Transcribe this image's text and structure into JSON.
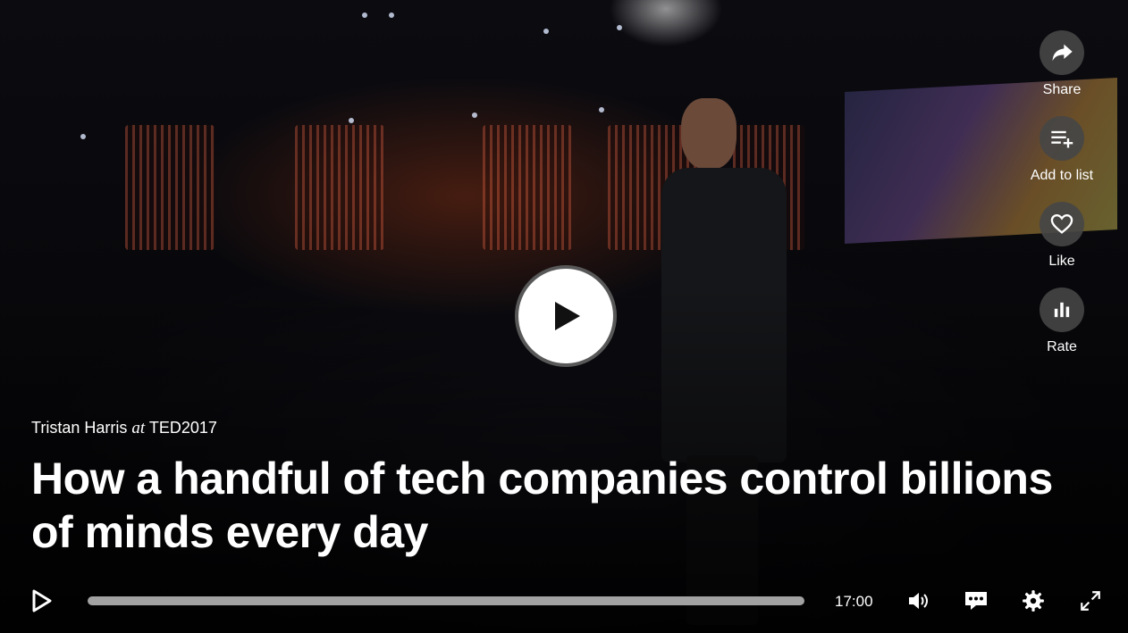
{
  "actions": {
    "share_label": "Share",
    "add_to_list_label": "Add to list",
    "like_label": "Like",
    "rate_label": "Rate"
  },
  "talk": {
    "speaker": "Tristan Harris",
    "at": "at",
    "event": "TED2017",
    "title": "How a handful of tech companies control billions of minds every day"
  },
  "player": {
    "duration": "17:00",
    "progress_fraction": 0,
    "icons": [
      "play-icon",
      "volume-icon",
      "captions-icon",
      "settings-icon",
      "fullscreen-icon",
      "share-icon",
      "add-to-list-icon",
      "heart-icon",
      "bar-chart-icon"
    ]
  },
  "colors": {
    "accent": "#e62b1e",
    "action_circle": "#464646",
    "progress_track": "#bebebe"
  }
}
